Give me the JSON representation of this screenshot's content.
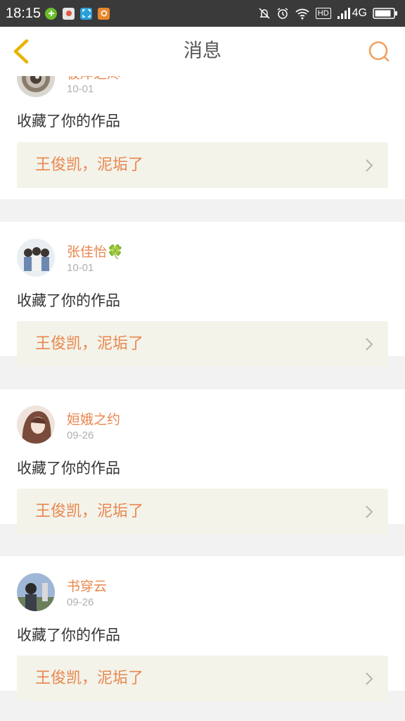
{
  "status_bar": {
    "time": "18:15",
    "network": "4G",
    "hd": "HD",
    "icons": [
      "plus-circle-icon",
      "app-icon",
      "scan-icon",
      "camera-icon",
      "mute-bell-icon",
      "alarm-icon",
      "wifi-icon",
      "hd-icon",
      "signal-icon",
      "battery-icon"
    ]
  },
  "header": {
    "title": "消息",
    "back_icon": "chevron-left-icon",
    "search_icon": "search-icon"
  },
  "colors": {
    "accent": "#e9874f",
    "back_icon": "#e8b400",
    "card_background": "#ffffff",
    "work_background": "#f3f3ea",
    "page_background": "#f2f2f2"
  },
  "messages": [
    {
      "username": "彼岸之烬",
      "date": "10-01",
      "action": "收藏了你的作品",
      "work_title": "王俊凯，泥垢了"
    },
    {
      "username": "张佳怡🍀",
      "date": "10-01",
      "action": "收藏了你的作品",
      "work_title": "王俊凯，泥垢了"
    },
    {
      "username": "姮娥之约",
      "date": "09-26",
      "action": "收藏了你的作品",
      "work_title": "王俊凯，泥垢了"
    },
    {
      "username": "书穿云",
      "date": "09-26",
      "action": "收藏了你的作品",
      "work_title": "王俊凯，泥垢了"
    }
  ]
}
